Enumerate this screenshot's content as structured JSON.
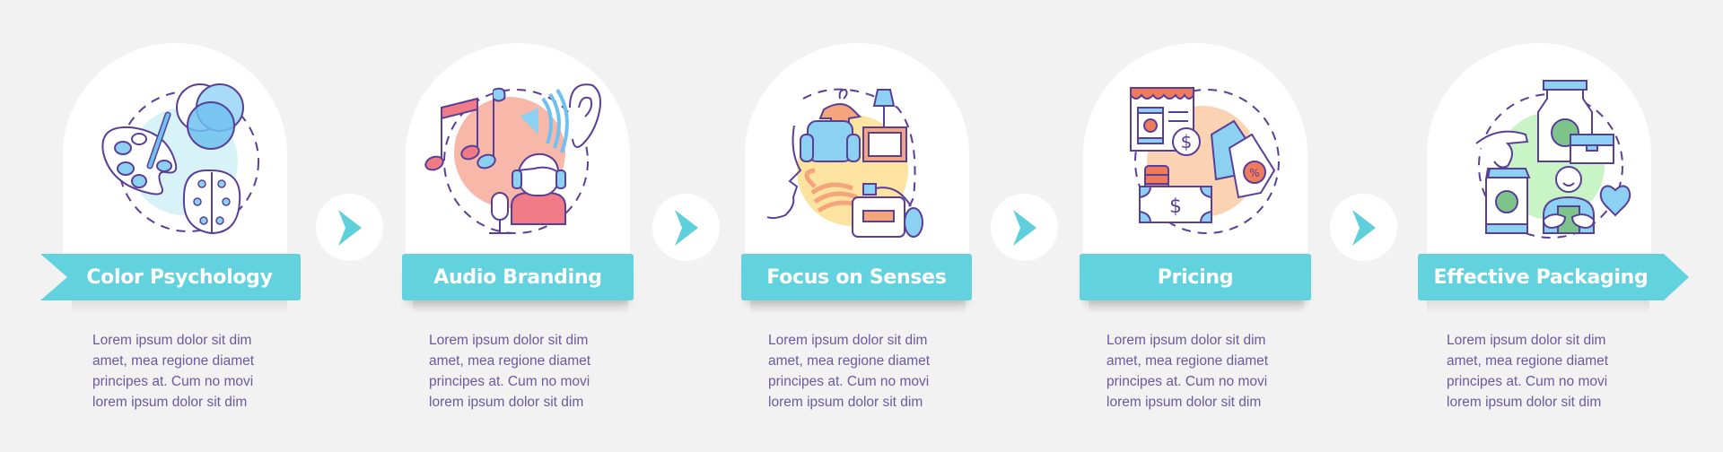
{
  "colors": {
    "background": "#f2f2f2",
    "card": "#ffffff",
    "ribbon": "#62d2de",
    "ribbon_text": "#ffffff",
    "description_text": "#6b5a9e",
    "arrow": "#5fcfdc",
    "outline": "#5a3f99"
  },
  "steps": [
    {
      "title": "Color Psychology",
      "icon": "palette-brain-venn-icon",
      "accent": "#d8f3f8",
      "description": [
        "Lorem ipsum dolor sit dim",
        "amet, mea regione diamet",
        "principes at. Cum no movi",
        "lorem ipsum dolor sit dim"
      ]
    },
    {
      "title": "Audio Branding",
      "icon": "music-ear-headset-icon",
      "accent": "#f7b8aa",
      "description": [
        "Lorem ipsum dolor sit dim",
        "amet, mea regione diamet",
        "principes at. Cum no movi",
        "lorem ipsum dolor sit dim"
      ]
    },
    {
      "title": "Focus on Senses",
      "icon": "senses-furniture-perfume-icon",
      "accent": "#fde3a0",
      "description": [
        "Lorem ipsum dolor sit dim",
        "amet, mea regione diamet",
        "principes at. Cum no movi",
        "lorem ipsum dolor sit dim"
      ]
    },
    {
      "title": "Pricing",
      "icon": "price-tag-money-icon",
      "accent": "#fcd3b2",
      "description": [
        "Lorem ipsum dolor sit dim",
        "amet, mea regione diamet",
        "principes at. Cum no movi",
        "lorem ipsum dolor sit dim"
      ]
    },
    {
      "title": "Effective Packaging",
      "icon": "packaging-customer-icon",
      "accent": "#c9f5c6",
      "description": [
        "Lorem ipsum dolor sit dim",
        "amet, mea regione diamet",
        "principes at. Cum no movi",
        "lorem ipsum dolor sit dim"
      ]
    }
  ],
  "arrows": [
    "next-arrow",
    "next-arrow",
    "next-arrow",
    "next-arrow"
  ]
}
